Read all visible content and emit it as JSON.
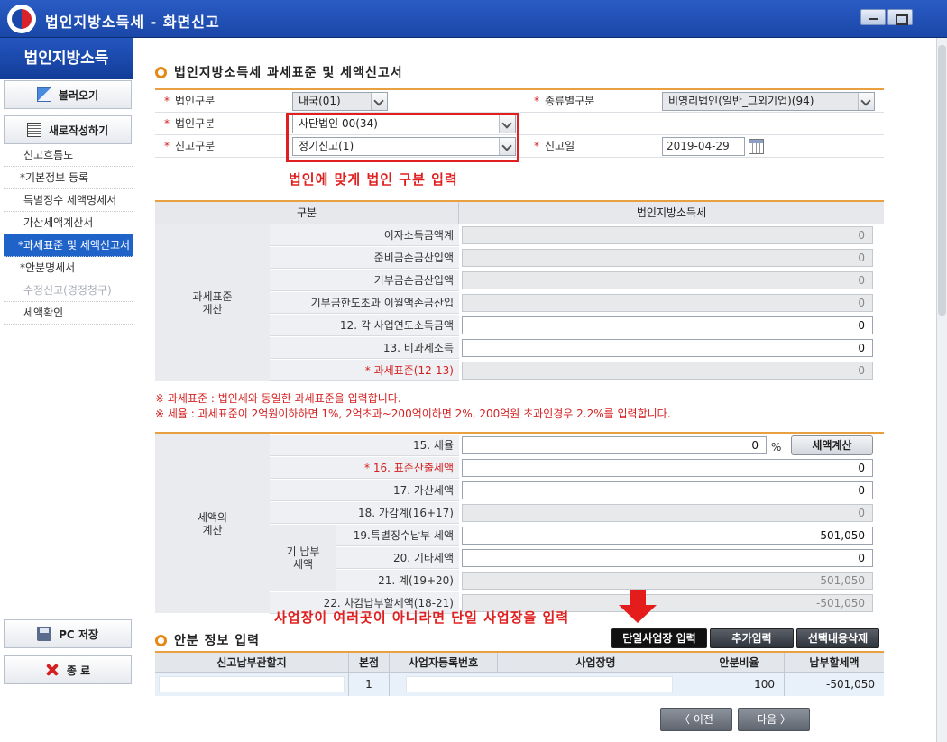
{
  "window": {
    "title": "법인지방소득세 - 화면신고"
  },
  "sidebar": {
    "header": "법인지방소득",
    "load_button": "불러오기",
    "new_button": "새로작성하기",
    "items": [
      {
        "label": "신고흐름도"
      },
      {
        "label": "*기본정보 등록"
      },
      {
        "label": "특별징수 세액명세서"
      },
      {
        "label": "가산세액계산서"
      },
      {
        "label": "*과세표준 및 세액신고서"
      },
      {
        "label": "*안분명세서"
      },
      {
        "label": "수정신고(경정청구)"
      },
      {
        "label": "세액확인"
      }
    ],
    "pc_save_button": "PC 저장",
    "exit_button": "종 료"
  },
  "main": {
    "section_title": "법인지방소득세 과세표준 및 세액신고서",
    "info": {
      "corp_type_label": "법인구분",
      "corp_type_value": "내국(01)",
      "category_label": "종류별구분",
      "category_value": "비영리법인(일반_그외기업)(94)",
      "corp_kind_label": "법인구분",
      "corp_kind_value": "사단법인 00(34)",
      "report_type_label": "신고구분",
      "report_type_value": "정기신고(1)",
      "report_date_label": "신고일",
      "report_date_value": "2019-04-29"
    },
    "annotation_1": "법인에 맞게 법인 구분 입력",
    "tax_base": {
      "col_category": "구분",
      "col_tax": "법인지방소득세",
      "group_label": "과세표준\n계산",
      "rows": [
        {
          "label": "이자소득금액계",
          "value": "0"
        },
        {
          "label": "준비금손금산입액",
          "value": "0"
        },
        {
          "label": "기부금손금산입액",
          "value": "0"
        },
        {
          "label": "기부금한도초과 이월액손금산입",
          "value": "0"
        },
        {
          "label": "12. 각 사업연도소득금액",
          "value": "0"
        },
        {
          "label": "13. 비과세소득",
          "value": "0"
        },
        {
          "label": "* 과세표준(12-13)",
          "value": "0"
        }
      ]
    },
    "notes": [
      "※ 과세표준 : 법인세와 동일한 과세표준을 입력합니다.",
      "※ 세율 : 과세표준이 2억원이하하면 1%, 2억초과~200억이하면 2%, 200억원 초과인경우 2.2%를 입력합니다."
    ],
    "tax_calc": {
      "group_label": "세액의\n계산",
      "sub_group_label": "기 납부\n세액",
      "rate_label": "15. 세율",
      "rate_value": "0",
      "rate_unit": "%",
      "calc_button": "세액계산",
      "rows": [
        {
          "label": "* 16. 표준산출세액",
          "value": "0"
        },
        {
          "label": "17. 가산세액",
          "value": "0"
        },
        {
          "label": "18. 가감계(16+17)",
          "value": "0"
        }
      ],
      "sub_rows": [
        {
          "label": "19.특별징수납부 세액",
          "value": "501,050"
        },
        {
          "label": "20. 기타세액",
          "value": "0"
        },
        {
          "label": "21. 계(19+20)",
          "value": "501,050"
        }
      ],
      "final_label": "22. 차감납부할세액(18-21)",
      "final_value": "-501,050"
    },
    "annotation_2": "사업장이 여러곳이 아니라면 단일 사업장을 입력",
    "alloc": {
      "title": "안분 정보 입력",
      "single_button": "단일사업장 입력",
      "add_button": "추가입력",
      "delete_button": "선택내용삭제",
      "headers": [
        "신고납부관할지",
        "본점",
        "사업자등록번호",
        "사업장명",
        "안분비율",
        "납부할세액"
      ],
      "row": {
        "jurisdiction": "",
        "head_office": "1",
        "biz_no": "",
        "biz_name": "",
        "ratio": "100",
        "tax": "-501,050"
      }
    },
    "prev_button": "〈 이전",
    "next_button": "다음 〉"
  }
}
